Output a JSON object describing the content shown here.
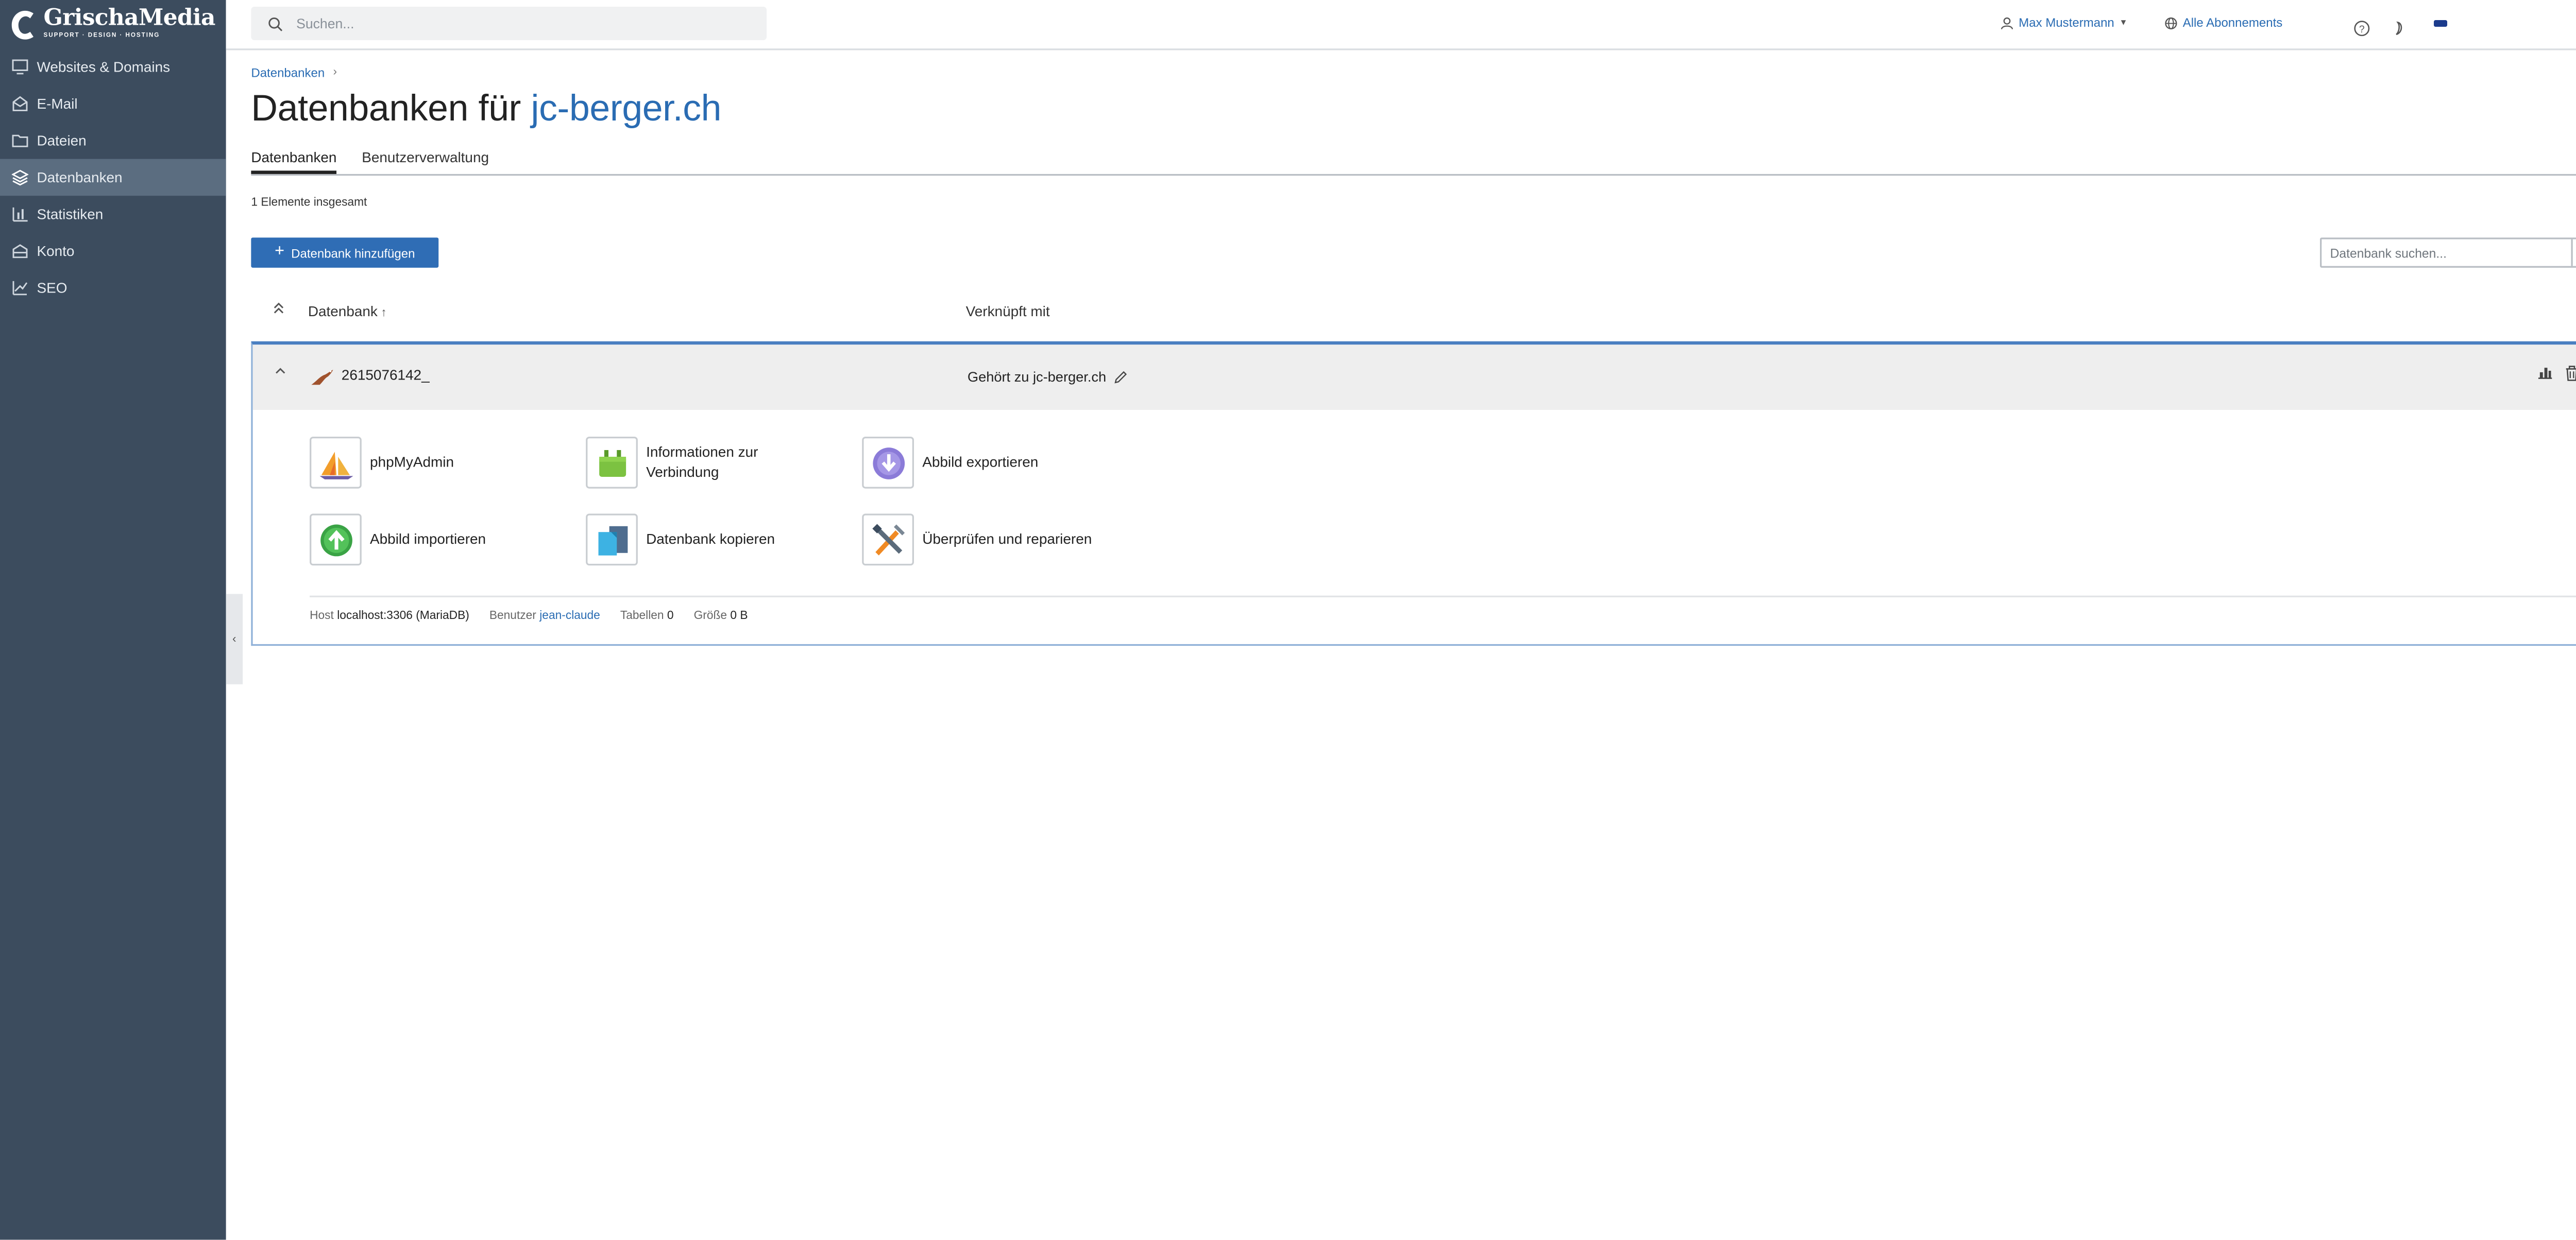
{
  "brand": {
    "name": "GrischaMedia",
    "tagline": "SUPPORT · DESIGN · HOSTING"
  },
  "sidebar": {
    "items": [
      {
        "label": "Websites & Domains",
        "icon": "monitor-icon",
        "active": false
      },
      {
        "label": "E-Mail",
        "icon": "envelope-icon",
        "active": false
      },
      {
        "label": "Dateien",
        "icon": "folder-icon",
        "active": false
      },
      {
        "label": "Datenbanken",
        "icon": "layers-icon",
        "active": true
      },
      {
        "label": "Statistiken",
        "icon": "bar-chart-icon",
        "active": false
      },
      {
        "label": "Konto",
        "icon": "account-icon",
        "active": false
      },
      {
        "label": "SEO",
        "icon": "trend-icon",
        "active": false
      }
    ]
  },
  "topbar": {
    "search_placeholder": "Suchen...",
    "user_name": "Max Mustermann",
    "subscriptions_label": "Alle Abonnements"
  },
  "breadcrumb": {
    "item": "Datenbanken",
    "separator": "›"
  },
  "page": {
    "title_prefix": "Datenbanken für",
    "title_domain": "jc-berger.ch"
  },
  "tabs": [
    {
      "label": "Datenbanken",
      "active": true
    },
    {
      "label": "Benutzerverwaltung",
      "active": false
    }
  ],
  "list": {
    "count_text": "1 Elemente insgesamt",
    "add_button_label": "Datenbank hinzufügen",
    "search_placeholder": "Datenbank suchen...",
    "columns": {
      "database": "Datenbank",
      "sort_arrow": "↑",
      "linked": "Verknüpft mit"
    }
  },
  "database": {
    "name": "2615076142_",
    "owner": "Gehört zu jc-berger.ch",
    "tools": [
      {
        "label": "phpMyAdmin",
        "icon": "phpmyadmin-icon"
      },
      {
        "label": "Informationen zur Verbindung",
        "icon": "plug-icon"
      },
      {
        "label": "Abbild exportieren",
        "icon": "export-icon"
      },
      {
        "label": "Abbild importieren",
        "icon": "import-icon"
      },
      {
        "label": "Datenbank kopieren",
        "icon": "copy-icon"
      },
      {
        "label": "Überprüfen und reparieren",
        "icon": "repair-icon"
      }
    ],
    "meta": {
      "host_label": "Host",
      "host_value": "localhost:3306 (MariaDB)",
      "user_label": "Benutzer",
      "user_value": "jean-claude",
      "tables_label": "Tabellen",
      "tables_value": "0",
      "size_label": "Größe",
      "size_value": "0 B"
    }
  },
  "colors": {
    "sidebar_bg": "#3c4c5e",
    "accent": "#2f6db5",
    "link": "#2a6cb3"
  }
}
